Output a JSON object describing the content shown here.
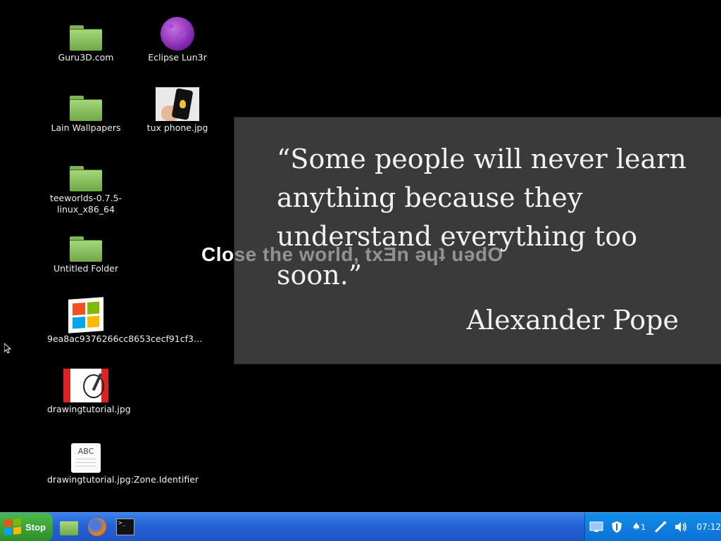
{
  "desktop": {
    "icons": [
      {
        "label": "Guru3D.com"
      },
      {
        "label": "Lain Wallpapers"
      },
      {
        "label": "teeworlds-0.7.5-linux_x86_64"
      },
      {
        "label": "Untitled Folder"
      },
      {
        "label": "9ea8ac9376266cc8653cecf91cf3…"
      },
      {
        "label": "drawingtutorial.jpg"
      },
      {
        "label": "drawingtutorial.jpg:Zone.Identifier"
      },
      {
        "label": "Eclipse Lun3r"
      },
      {
        "label": "tux phone.jpg"
      }
    ]
  },
  "quote": {
    "text": "“Some people will never learn anything because they understand everything too soon.”",
    "author": "Alexander Pope"
  },
  "screensaver": {
    "part1": "Clo",
    "part2": "se the world, txƎn ǝɥʇ uǝdO"
  },
  "taskbar": {
    "start_label": "Stop",
    "clock": "07:12",
    "tray_badge": "1",
    "file_icon_text": "ABC",
    "terminal_text": ">_"
  }
}
